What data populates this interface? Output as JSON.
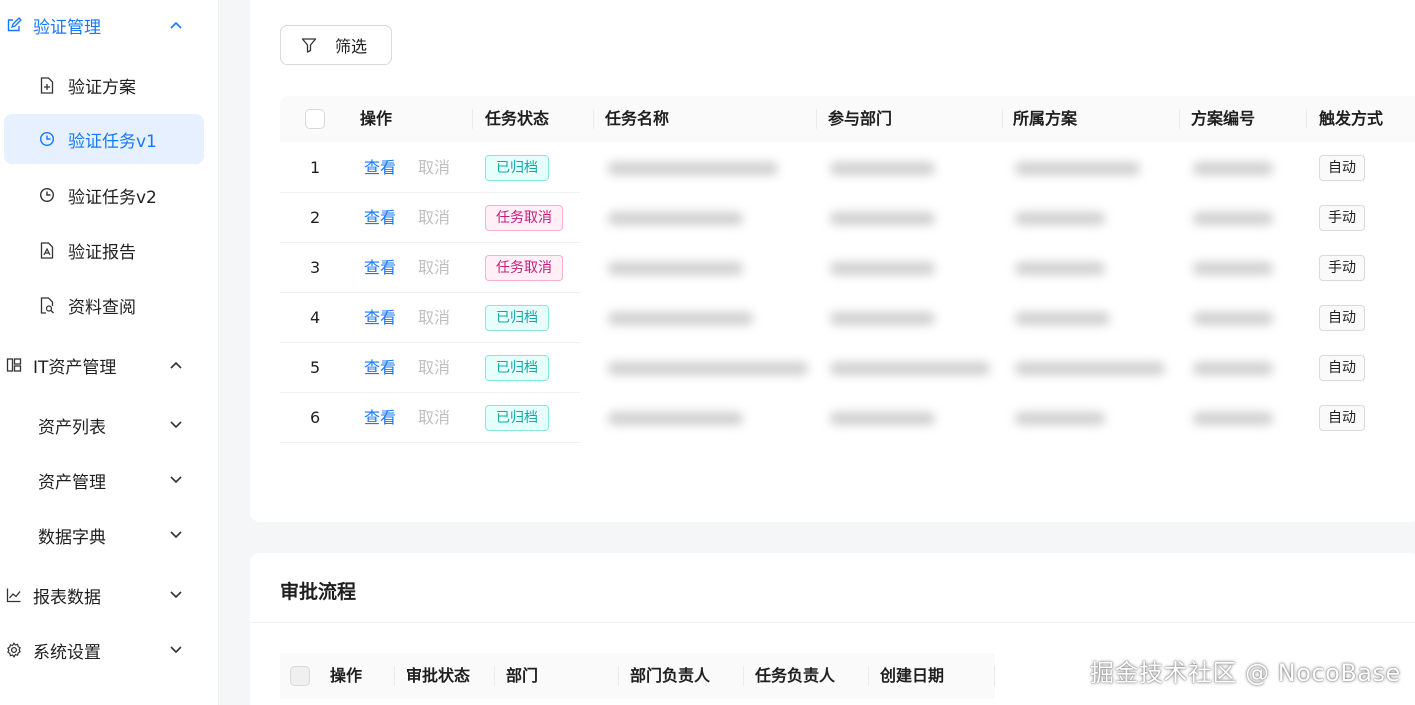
{
  "sidebar": {
    "groups": [
      {
        "label": "验证管理",
        "icon": "edit-icon",
        "expanded": true
      },
      {
        "label": "IT资产管理",
        "icon": "apps-icon",
        "expanded": true
      },
      {
        "label": "报表数据",
        "icon": "line-chart-icon",
        "expanded": false
      },
      {
        "label": "系统设置",
        "icon": "setting-icon",
        "expanded": false
      }
    ],
    "verify_items": [
      {
        "label": "验证方案",
        "icon": "file-add-icon"
      },
      {
        "label": "验证任务v1",
        "icon": "clock-circle-icon"
      },
      {
        "label": "验证任务v2",
        "icon": "clock-circle-icon"
      },
      {
        "label": "验证报告",
        "icon": "file-pdf-icon"
      },
      {
        "label": "资料查阅",
        "icon": "file-search-icon"
      }
    ],
    "asset_items": [
      {
        "label": "资产列表"
      },
      {
        "label": "资产管理"
      },
      {
        "label": "数据字典"
      }
    ]
  },
  "tasks": {
    "filter_label": "筛选",
    "columns": [
      "操作",
      "任务状态",
      "任务名称",
      "参与部门",
      "所属方案",
      "方案编号",
      "触发方式"
    ],
    "view_label": "查看",
    "cancel_label": "取消",
    "rows": [
      {
        "index": "1",
        "status": "已归档",
        "status_color": "green",
        "trigger": "自动"
      },
      {
        "index": "2",
        "status": "任务取消",
        "status_color": "pink",
        "trigger": "手动"
      },
      {
        "index": "3",
        "status": "任务取消",
        "status_color": "pink",
        "trigger": "手动"
      },
      {
        "index": "4",
        "status": "已归档",
        "status_color": "green",
        "trigger": "自动"
      },
      {
        "index": "5",
        "status": "已归档",
        "status_color": "green",
        "trigger": "自动"
      },
      {
        "index": "6",
        "status": "已归档",
        "status_color": "green",
        "trigger": "自动"
      }
    ]
  },
  "approval": {
    "title": "审批流程",
    "columns": [
      "操作",
      "审批状态",
      "部门",
      "部门负责人",
      "任务负责人",
      "创建日期"
    ]
  },
  "watermark": "掘金技术社区 @ NocoBase",
  "colors": {
    "accent": "#1677ff",
    "selected_bg": "#e6f0ff",
    "archived": "#13a8a8",
    "cancelled": "#c41d7f"
  }
}
